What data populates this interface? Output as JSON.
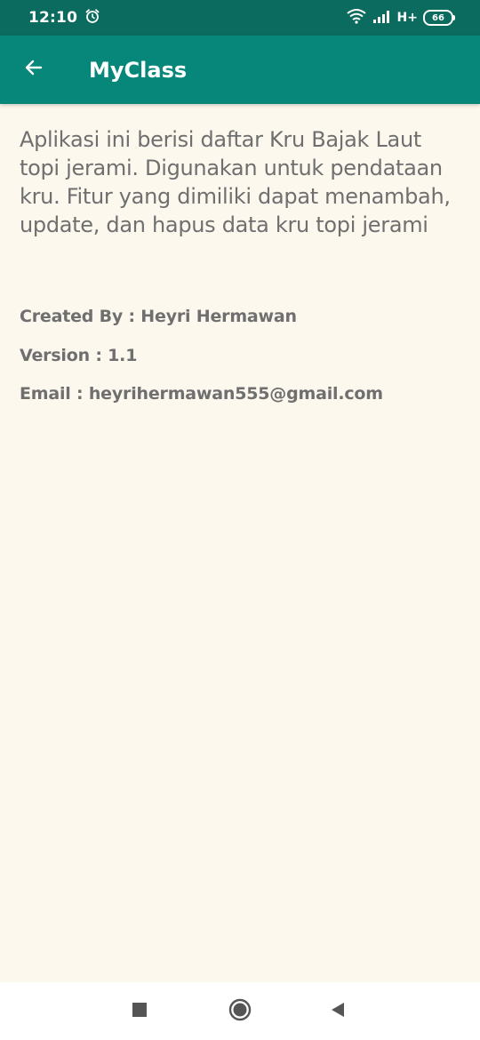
{
  "status_bar": {
    "time": "12:10",
    "network": "H+",
    "battery_level": "66",
    "icons": [
      "alarm-icon",
      "wifi-icon",
      "signal-icon",
      "battery-icon"
    ]
  },
  "app_bar": {
    "title": "MyClass",
    "back_icon": "arrow-left-icon",
    "background_color": "#06877a"
  },
  "content": {
    "description": "Aplikasi ini berisi daftar Kru Bajak Laut topi jerami. Digunakan untuk pendataan kru. Fitur yang dimiliki dapat menambah, update, dan hapus data kru topi jerami",
    "created_by": "Created By : Heyri Hermawan",
    "version": "Version : 1.1",
    "email": "Email : heyrihermawan555@gmail.com"
  },
  "nav_bar": {
    "icons": [
      "recents-square-icon",
      "home-circle-icon",
      "back-triangle-icon"
    ]
  },
  "colors": {
    "status_bar": "#0b6b5e",
    "background": "#fdf8ee",
    "text": "#6f6f6f"
  }
}
